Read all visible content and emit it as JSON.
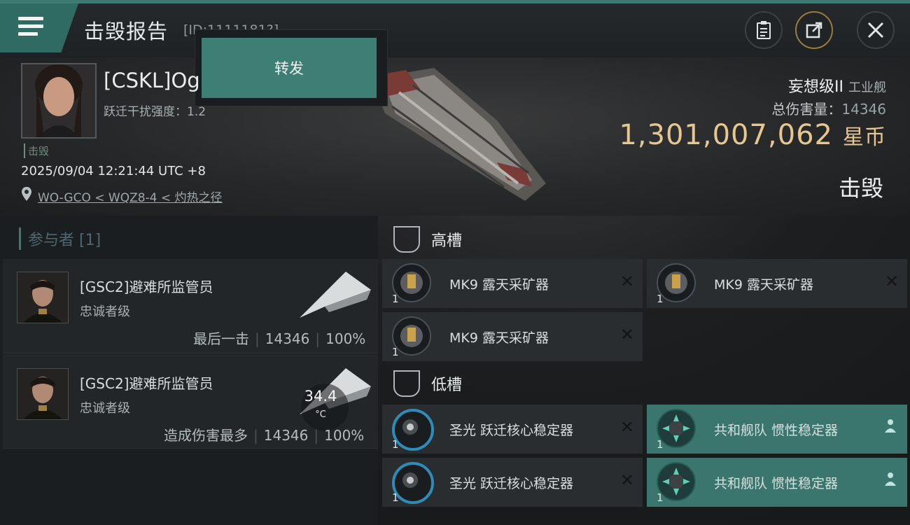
{
  "header": {
    "title": "击毁报告",
    "id_text": "[ID:1111181?]",
    "icons": [
      "menu-icon",
      "clipboard-icon",
      "share-icon",
      "close-icon"
    ]
  },
  "popup": {
    "forward_label": "转发"
  },
  "victim": {
    "name": "[CSKL]Og",
    "warp_disrupt": "跃迁干扰强度：1.2",
    "tag": "击毁",
    "datetime": "2025/09/04 12:21:44 UTC +8",
    "location": "WO-GCO < WQZ8-4 < 灼热之径",
    "ship_class": "妄想级II",
    "ship_type": "工业舰",
    "total_damage_label": "总伤害量：",
    "total_damage": "14346",
    "isk_value": "1,301,007,062",
    "isk_unit": "星币",
    "status": "击毁"
  },
  "participants": {
    "header": "参与者 [1]",
    "rows": [
      {
        "name": "[GSC2]避难所监管员",
        "ship": "忠诚者级",
        "label": "最后一击",
        "damage": "14346",
        "percent": "100%"
      },
      {
        "name": "[GSC2]避难所监管员",
        "ship": "忠诚者级",
        "label": "造成伤害最多",
        "damage": "14346",
        "percent": "100%"
      }
    ]
  },
  "slots": {
    "high": {
      "title": "高槽",
      "modules": [
        {
          "name": "MK9 露天采矿器",
          "qty": "1"
        },
        {
          "name": "MK9 露天采矿器",
          "qty": "1"
        },
        {
          "name": "MK9 露天采矿器",
          "qty": "1"
        }
      ]
    },
    "low": {
      "title": "低槽",
      "modules": [
        {
          "name": "圣光 跃迁核心稳定器",
          "qty": "1"
        },
        {
          "name": "共和舰队 惯性稳定器",
          "qty": "1"
        },
        {
          "name": "圣光 跃迁核心稳定器",
          "qty": "1"
        },
        {
          "name": "共和舰队 惯性稳定器",
          "qty": "1"
        }
      ]
    }
  },
  "overlay": {
    "temperature": "34.4",
    "temperature_unit": "°C"
  },
  "colors": {
    "accent": "#3d7e75",
    "isk": "#e8c68f",
    "panel": "#2a2d2f"
  }
}
